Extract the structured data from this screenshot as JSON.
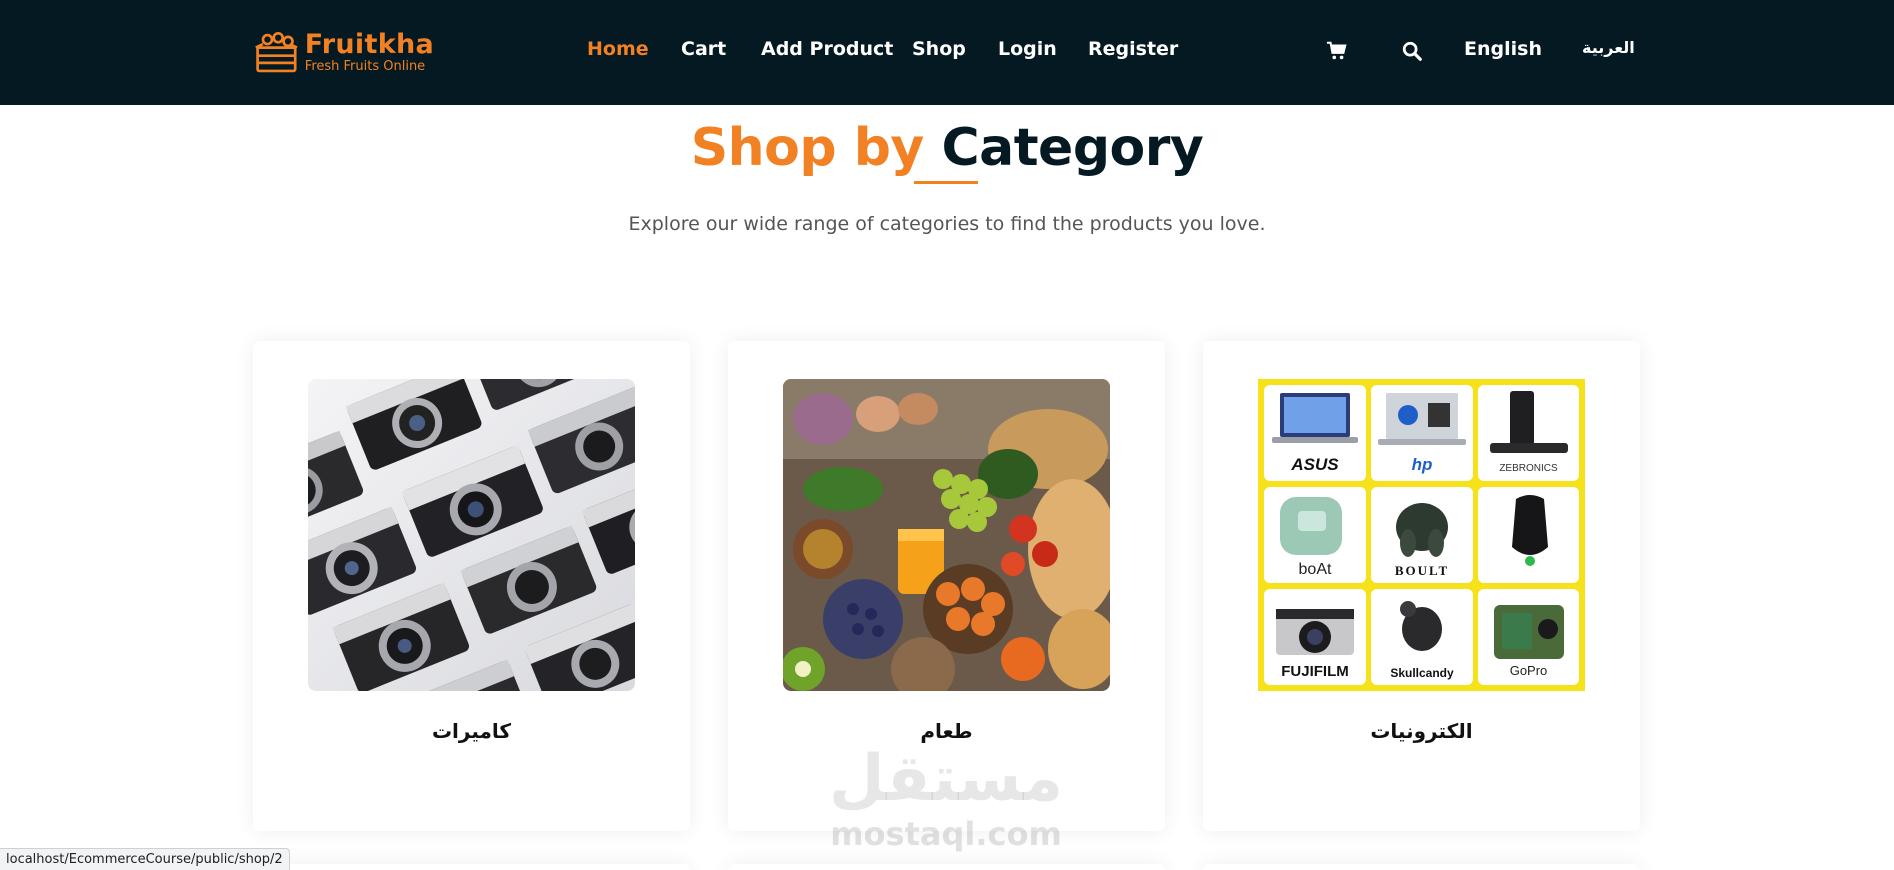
{
  "brand": {
    "name": "Fruitkha",
    "tagline": "Fresh Fruits Online",
    "accent_color": "#F28123",
    "nav_bg_color": "#051922"
  },
  "nav": {
    "items": [
      {
        "label": "Home",
        "active": true
      },
      {
        "label": "Cart"
      },
      {
        "label": "Add Product"
      },
      {
        "label": "Shop"
      },
      {
        "label": "Login"
      },
      {
        "label": "Register"
      }
    ],
    "cart_icon": "shopping-cart-icon",
    "search_icon": "search-icon",
    "lang_en": "English",
    "lang_ar": "العربية"
  },
  "section": {
    "title_highlight": "Shop by",
    "title_rest": "Category",
    "subtitle": "Explore our wide range of categories to find the products you love."
  },
  "categories": [
    {
      "label": "كاميرات",
      "image": "cameras-photo"
    },
    {
      "label": "طعام",
      "image": "food-photo"
    },
    {
      "label": "الكترونيات",
      "image": "electronics-brands-collage"
    }
  ],
  "electronics_brands": [
    "ASUS",
    "hp",
    "ZEBRONICS",
    "boAt",
    "BOULT",
    "",
    "FUJIFILM",
    "Skullcandy",
    "GoPro"
  ],
  "watermark": {
    "arabic": "مستقل",
    "latin": "mostaql.com"
  },
  "status_bar": {
    "url": "localhost/EcommerceCourse/public/shop/2"
  }
}
